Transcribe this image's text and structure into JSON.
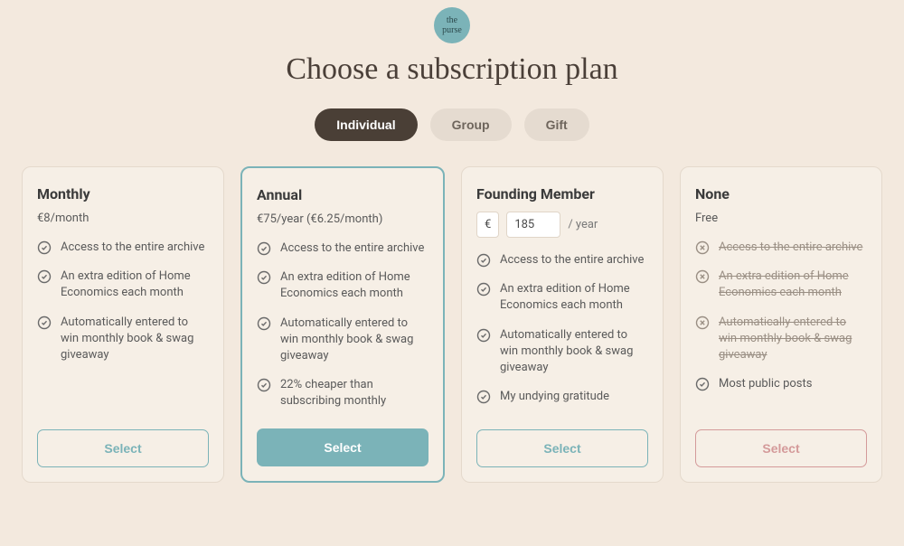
{
  "header": {
    "logo_text": "the\npurse",
    "title": "Choose a subscription plan"
  },
  "toggles": {
    "individual": "Individual",
    "group": "Group",
    "gift": "Gift"
  },
  "plans": {
    "monthly": {
      "name": "Monthly",
      "price": "€8/month",
      "features": [
        "Access to the entire archive",
        "An extra edition of Home Economics each month",
        "Automatically entered to win monthly book & swag giveaway"
      ],
      "select": "Select"
    },
    "annual": {
      "name": "Annual",
      "price": "€75/year (€6.25/month)",
      "features": [
        "Access to the entire archive",
        "An extra edition of Home Economics each month",
        "Automatically entered to win monthly book & swag giveaway",
        "22% cheaper than subscribing monthly"
      ],
      "select": "Select"
    },
    "founding": {
      "name": "Founding Member",
      "currency": "€",
      "amount": "185",
      "period": "/ year",
      "features": [
        "Access to the entire archive",
        "An extra edition of Home Economics each month",
        "Automatically entered to win monthly book & swag giveaway",
        "My undying gratitude"
      ],
      "select": "Select"
    },
    "none": {
      "name": "None",
      "price": "Free",
      "excluded": [
        "Access to the entire archive",
        "An extra edition of Home Economics each month",
        "Automatically entered to win monthly book & swag giveaway"
      ],
      "included": [
        "Most public posts"
      ],
      "select": "Select"
    }
  }
}
